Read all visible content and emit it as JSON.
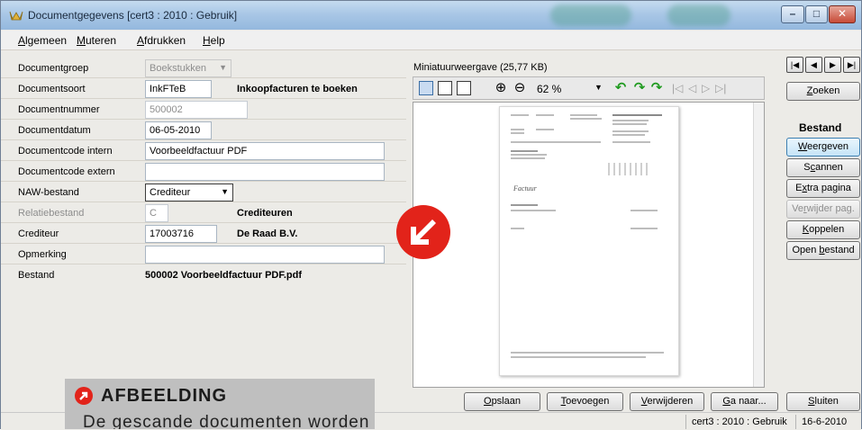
{
  "window": {
    "title": "Documentgegevens  [cert3 : 2010 : Gebruik]",
    "minimize_icon": "minimize-icon",
    "maximize_icon": "maximize-icon",
    "close_icon": "close-icon"
  },
  "menu": {
    "items": [
      {
        "accel": "A",
        "rest": "lgemeen"
      },
      {
        "accel": "M",
        "rest": "uteren"
      },
      {
        "accel": "A",
        "rest": "fdrukken"
      },
      {
        "accel": "H",
        "rest": "elp"
      }
    ]
  },
  "form": {
    "documentgroep": {
      "label": "Documentgroep",
      "value": "Boekstukken"
    },
    "documentsoort": {
      "label": "Documentsoort",
      "value": "InkFTeB",
      "description": "Inkoopfacturen te boeken"
    },
    "documentnummer": {
      "label": "Documentnummer",
      "value": "500002"
    },
    "documentdatum": {
      "label": "Documentdatum",
      "value": "06-05-2010"
    },
    "code_intern": {
      "label": "Documentcode intern",
      "value": "Voorbeeldfactuur PDF"
    },
    "code_extern": {
      "label": "Documentcode extern",
      "value": ""
    },
    "naw_bestand": {
      "label": "NAW-bestand",
      "value": "Crediteur"
    },
    "relatiebestand": {
      "label": "Relatiebestand",
      "value": "C",
      "description": "Crediteuren"
    },
    "crediteur": {
      "label": "Crediteur",
      "value": "17003716",
      "description": "De Raad B.V."
    },
    "opmerking": {
      "label": "Opmerking",
      "value": ""
    },
    "bestand": {
      "label": "Bestand",
      "value": "500002 Voorbeeldfactuur PDF.pdf"
    }
  },
  "preview": {
    "caption": "Miniatuurweergave (25,77 KB)",
    "zoom": "62 %",
    "page_title": "Factuur"
  },
  "navigation": {
    "first": "first-record-icon",
    "prev": "previous-record-icon",
    "next": "next-record-icon",
    "last": "last-record-icon"
  },
  "side": {
    "zoeken": {
      "accel": "Z",
      "rest": "oeken"
    },
    "section_title": "Bestand",
    "weergeven": {
      "accel": "W",
      "rest": "eergeven"
    },
    "scannen": {
      "pre": "S",
      "accel": "c",
      "rest": "annen"
    },
    "extra": {
      "pre": "E",
      "accel": "x",
      "rest": "tra pagina"
    },
    "verwijder_pag": {
      "pre": "Ve",
      "accel": "r",
      "rest": "wijder pag."
    },
    "koppelen": {
      "accel": "K",
      "rest": "oppelen"
    },
    "open_bestand": {
      "pre": "Open ",
      "accel": "b",
      "rest": "estand"
    }
  },
  "bottom": {
    "opslaan": {
      "accel": "O",
      "rest": "pslaan"
    },
    "toevoegen": {
      "accel": "T",
      "rest": "oevoegen"
    },
    "verwijderen": {
      "accel": "V",
      "rest": "erwijderen"
    },
    "ganaar": {
      "accel": "G",
      "rest": "a naar..."
    },
    "sluiten": {
      "accel": "S",
      "rest": "luiten"
    }
  },
  "status": {
    "context": "cert3 : 2010 : Gebruik",
    "date": "16-6-2010"
  },
  "overlay": {
    "heading": "AFBEELDING",
    "text": "De gescande documenten worden"
  }
}
